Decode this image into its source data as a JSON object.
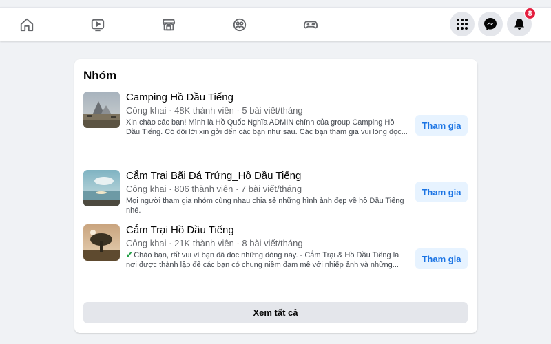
{
  "topbar": {
    "nav_icons": [
      "home-icon",
      "watch-icon",
      "marketplace-icon",
      "groups-icon",
      "gaming-icon"
    ],
    "right_icons": [
      "menu-grid-icon",
      "messenger-icon",
      "notifications-icon"
    ],
    "notification_count": "8"
  },
  "groups_card": {
    "title": "Nhóm",
    "join_label": "Tham gia",
    "see_all_label": "Xem tất cả",
    "groups": [
      {
        "name": "Camping Hồ Dầu Tiếng",
        "meta": "Công khai · 48K thành viên · 5 bài viết/tháng",
        "description": "Xin chào các bạn! Mình là Hồ Quốc Nghĩa ADMIN chính của group Camping Hồ Dầu Tiếng. Có đôi lời xin gởi đến các bạn như sau. Các bạn tham gia vui lòng đọc...",
        "check": ""
      },
      {
        "name": "Cắm Trại Bãi Đá Trứng_Hồ Dầu Tiếng",
        "meta": "Công khai · 806 thành viên · 7 bài viết/tháng",
        "description": "Mọi người tham gia nhóm cùng nhau chia sẻ những hình ảnh đẹp về hồ Dầu Tiếng nhé.",
        "check": ""
      },
      {
        "name": "Cắm Trại Hồ Dầu Tiếng",
        "meta": "Công khai · 21K thành viên · 8 bài viết/tháng",
        "description": "Chào bạn, rất vui vì bạn đã đọc những dòng này. - Cắm Trại & Hồ Dầu Tiếng là nơi được thành lập để các bạn có chung niềm đam mê với nhiếp ảnh và những...",
        "check": "✔"
      }
    ]
  },
  "colors": {
    "accent": "#1b74e4",
    "join_bg": "#e7f3ff",
    "badge": "#e41e3f",
    "page_bg": "#f0f2f5"
  }
}
